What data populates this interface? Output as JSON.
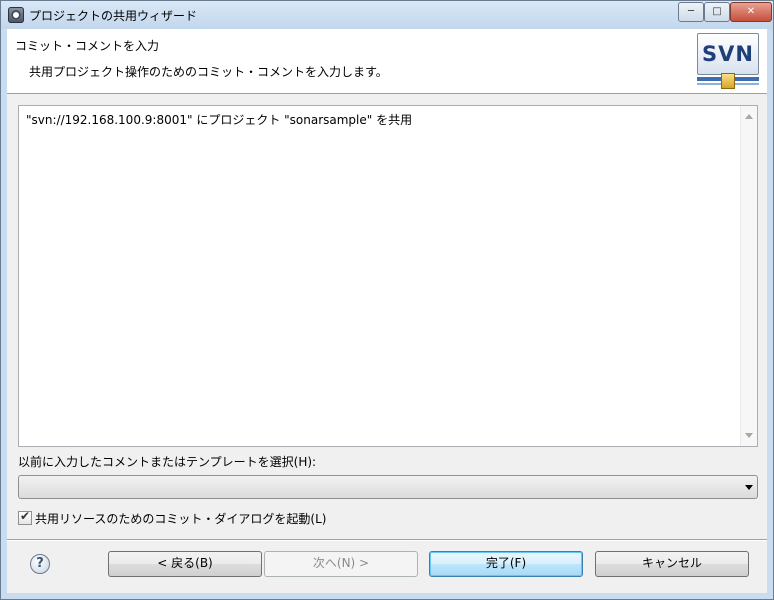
{
  "window": {
    "title": "プロジェクトの共用ウィザード",
    "controls": {
      "minimize": "─",
      "maximize": "□",
      "close": "✕"
    }
  },
  "banner": {
    "title": "コミット・コメントを入力",
    "description": "共用プロジェクト操作のためのコミット・コメントを入力します。",
    "logo_text": "SVN"
  },
  "comment": {
    "value": "\"svn://192.168.100.9:8001\" にプロジェクト \"sonarsample\" を共用"
  },
  "previous_comments": {
    "label": "以前に入力したコメントまたはテンプレートを選択(H):",
    "selected": ""
  },
  "launch_dialog": {
    "label": "共用リソースのためのコミット・ダイアログを起動(L)",
    "checked": true
  },
  "buttons": {
    "back": "< 戻る(B)",
    "next": "次へ(N) >",
    "finish": "完了(F)",
    "cancel": "キャンセル"
  },
  "icons": {
    "help": "help-icon",
    "app": "eclipse-app-icon"
  }
}
